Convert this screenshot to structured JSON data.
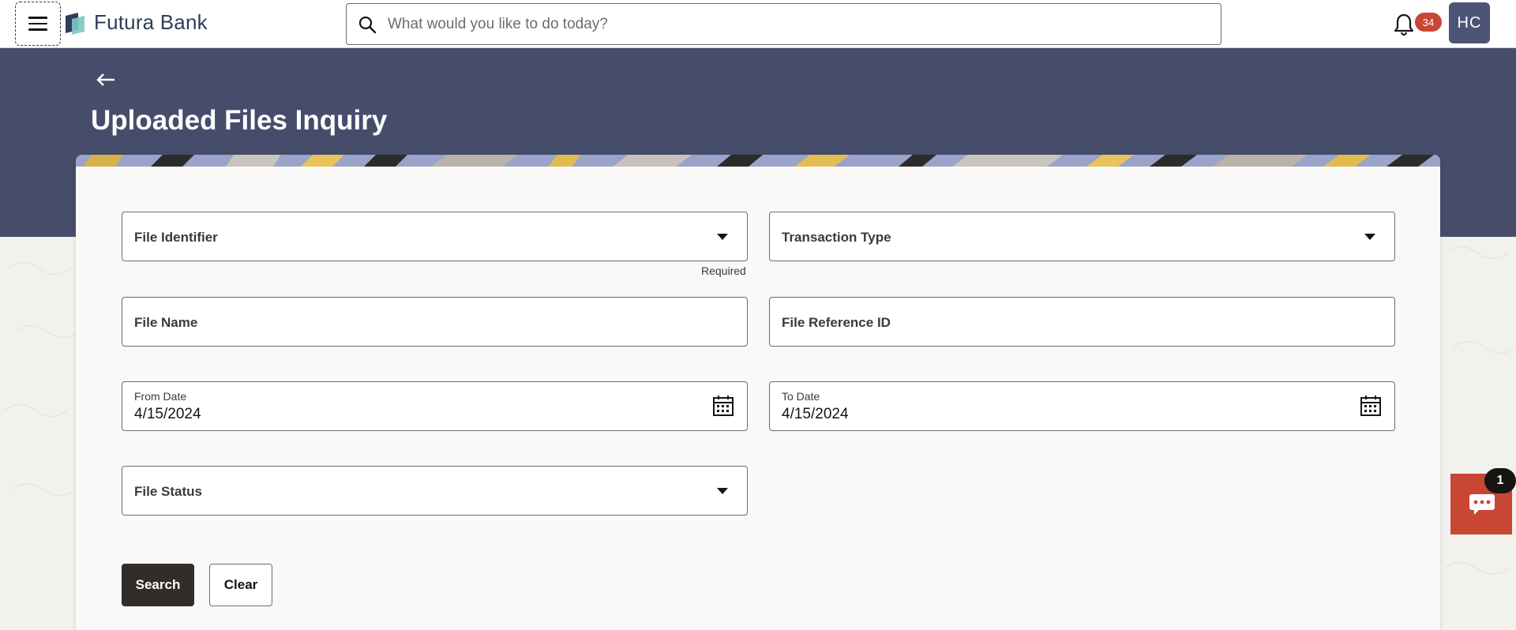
{
  "header": {
    "menu_icon": "hamburger-icon",
    "brand_name": "Futura Bank",
    "search_placeholder": "What would you like to do today?",
    "notification_count": "34",
    "avatar_initials": "HC"
  },
  "page": {
    "back_icon": "arrow-left-icon",
    "title": "Uploaded Files Inquiry"
  },
  "form": {
    "file_identifier": {
      "label": "File Identifier",
      "helper": "Required"
    },
    "transaction_type": {
      "label": "Transaction Type"
    },
    "file_name": {
      "label": "File Name"
    },
    "file_reference_id": {
      "label": "File Reference ID"
    },
    "from_date": {
      "label": "From Date",
      "value": "4/15/2024"
    },
    "to_date": {
      "label": "To Date",
      "value": "4/15/2024"
    },
    "file_status": {
      "label": "File Status"
    },
    "search_button": "Search",
    "clear_button": "Clear"
  },
  "chat": {
    "unread": "1",
    "icon": "chat-icon"
  },
  "colors": {
    "banner": "#464d6b",
    "primary_button": "#312d2a",
    "accent_red": "#c74634",
    "avatar_bg": "#4b5475"
  }
}
